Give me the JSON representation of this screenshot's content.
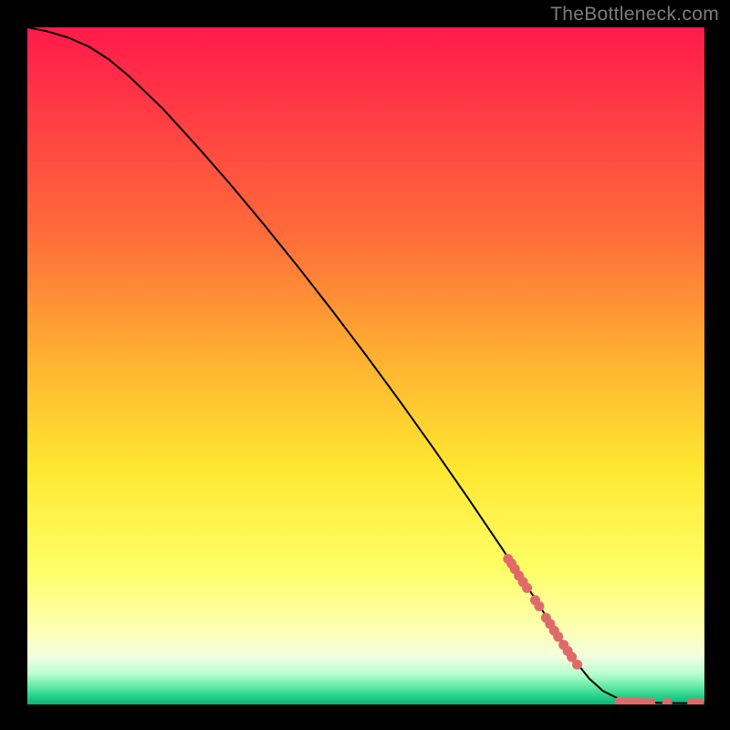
{
  "watermark": "TheBottleneck.com",
  "chart_data": {
    "type": "line",
    "title": "",
    "xlabel": "",
    "ylabel": "",
    "xlim": [
      0,
      100
    ],
    "ylim": [
      0,
      100
    ],
    "grid": false,
    "background_gradient": {
      "stops": [
        {
          "offset": 0.0,
          "color": "#ff1a4b"
        },
        {
          "offset": 0.3,
          "color": "#ff6a3a"
        },
        {
          "offset": 0.5,
          "color": "#ffb531"
        },
        {
          "offset": 0.65,
          "color": "#ffe731"
        },
        {
          "offset": 0.8,
          "color": "#ffff66"
        },
        {
          "offset": 0.89,
          "color": "#ffffb3"
        },
        {
          "offset": 0.93,
          "color": "#f0ffe0"
        },
        {
          "offset": 0.955,
          "color": "#b8ffcd"
        },
        {
          "offset": 0.975,
          "color": "#5de8a3"
        },
        {
          "offset": 0.99,
          "color": "#1ecc87"
        },
        {
          "offset": 1.0,
          "color": "#0fb273"
        }
      ]
    },
    "series": [
      {
        "name": "curve",
        "stroke": "#000000",
        "stroke_width": 2,
        "x": [
          0,
          3,
          6,
          9,
          12,
          15,
          20,
          25,
          30,
          35,
          40,
          45,
          50,
          55,
          60,
          65,
          70,
          75,
          78,
          81,
          83,
          85,
          87,
          89,
          91,
          93,
          95,
          97,
          100
        ],
        "y": [
          100,
          99.4,
          98.5,
          97.2,
          95.3,
          92.8,
          88.0,
          82.5,
          76.8,
          70.8,
          64.6,
          58.2,
          51.6,
          44.8,
          37.8,
          30.6,
          23.2,
          15.6,
          10.8,
          6.3,
          3.8,
          2.0,
          1.0,
          0.5,
          0.3,
          0.25,
          0.2,
          0.2,
          0.2
        ]
      }
    ],
    "markers": {
      "name": "highlight-points",
      "color": "#e06a6a",
      "radius": 5.5,
      "points": [
        {
          "x": 71.0,
          "y": 21.5
        },
        {
          "x": 71.5,
          "y": 20.8
        },
        {
          "x": 72.0,
          "y": 20.0
        },
        {
          "x": 72.6,
          "y": 19.0
        },
        {
          "x": 73.2,
          "y": 18.1
        },
        {
          "x": 73.8,
          "y": 17.2
        },
        {
          "x": 75.0,
          "y": 15.4
        },
        {
          "x": 75.6,
          "y": 14.5
        },
        {
          "x": 76.6,
          "y": 12.8
        },
        {
          "x": 77.2,
          "y": 11.9
        },
        {
          "x": 77.8,
          "y": 10.9
        },
        {
          "x": 78.4,
          "y": 10.0
        },
        {
          "x": 79.2,
          "y": 8.8
        },
        {
          "x": 79.8,
          "y": 7.9
        },
        {
          "x": 80.4,
          "y": 7.0
        },
        {
          "x": 81.2,
          "y": 5.9
        },
        {
          "x": 87.5,
          "y": 0.4
        },
        {
          "x": 88.5,
          "y": 0.35
        },
        {
          "x": 89.3,
          "y": 0.3
        },
        {
          "x": 90.0,
          "y": 0.3
        },
        {
          "x": 90.8,
          "y": 0.28
        },
        {
          "x": 92.0,
          "y": 0.25
        },
        {
          "x": 94.5,
          "y": 0.22
        },
        {
          "x": 98.2,
          "y": 0.2
        },
        {
          "x": 99.2,
          "y": 0.2
        }
      ]
    }
  }
}
